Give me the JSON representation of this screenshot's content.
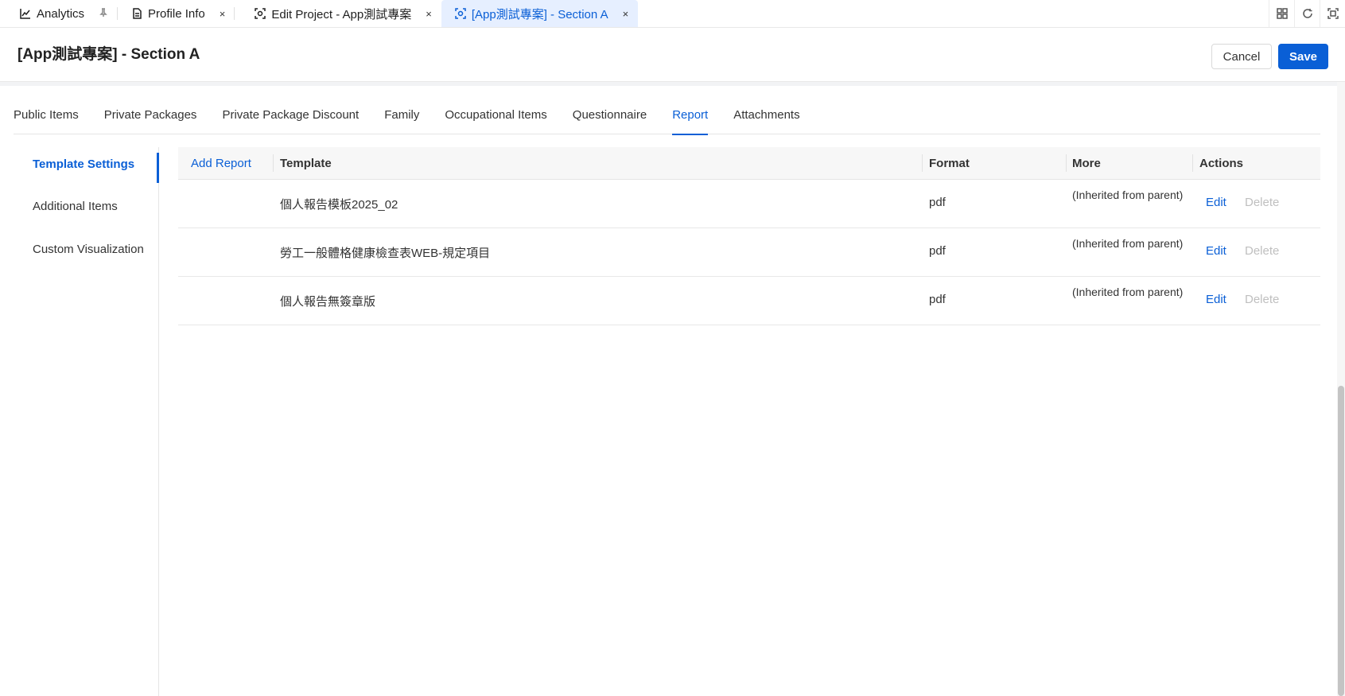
{
  "tabs_bar": {
    "tabs": [
      {
        "label": "Analytics",
        "icon": "chart-line-icon",
        "action_icon": "pin-icon"
      },
      {
        "label": "Profile Info",
        "icon": "document-icon",
        "action_icon": "close-icon"
      },
      {
        "label": "Edit Project - App測試專案",
        "icon": "project-scan-icon",
        "action_icon": "close-icon"
      },
      {
        "label": "[App測試專案] - Section A",
        "icon": "project-scan-icon",
        "action_icon": "close-icon",
        "active": true
      }
    ],
    "close_glyph": "×",
    "pin_glyph": "⊥",
    "tools": [
      "grid-icon",
      "refresh-icon",
      "fullscreen-icon"
    ]
  },
  "header": {
    "title": "[App測試專案] - Section A",
    "cancel_label": "Cancel",
    "save_label": "Save"
  },
  "section_tabs": [
    {
      "label": "Public Items"
    },
    {
      "label": "Private Packages"
    },
    {
      "label": "Private Package Discount"
    },
    {
      "label": "Family"
    },
    {
      "label": "Occupational Items"
    },
    {
      "label": "Questionnaire"
    },
    {
      "label": "Report",
      "active": true
    },
    {
      "label": "Attachments"
    }
  ],
  "side_menu": [
    {
      "label": "Template Settings",
      "active": true
    },
    {
      "label": "Additional Items"
    },
    {
      "label": "Custom Visualization"
    }
  ],
  "table": {
    "add_report_label": "Add Report",
    "columns": {
      "template": "Template",
      "format": "Format",
      "more": "More",
      "actions": "Actions"
    },
    "rows": [
      {
        "template": "個人報告模板2025_02",
        "format": "pdf",
        "more": "(Inherited from parent)",
        "edit": "Edit",
        "delete": "Delete"
      },
      {
        "template": "勞工一般體格健康檢查表WEB-規定項目",
        "format": "pdf",
        "more": "(Inherited from parent)",
        "edit": "Edit",
        "delete": "Delete"
      },
      {
        "template": "個人報告無簽章版",
        "format": "pdf",
        "more": "(Inherited from parent)",
        "edit": "Edit",
        "delete": "Delete"
      }
    ]
  },
  "colors": {
    "accent": "#0a5fd6",
    "active_tab_bg": "#e6efff",
    "disabled_text": "#bfbfbf"
  }
}
